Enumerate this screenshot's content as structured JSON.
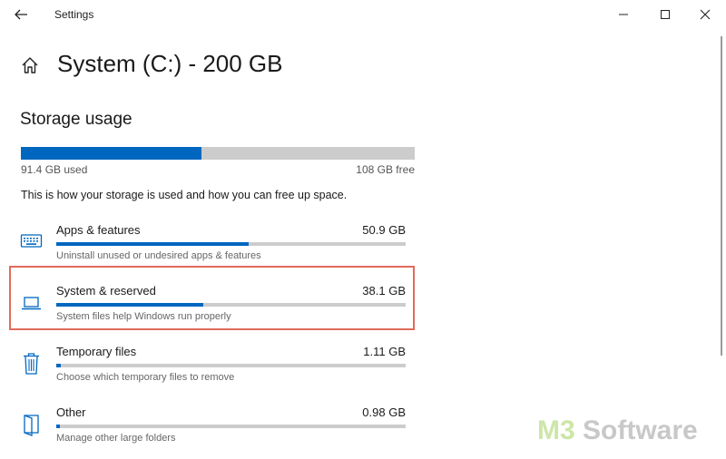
{
  "window": {
    "title": "Settings"
  },
  "page": {
    "title": "System (C:) - 200 GB"
  },
  "storage": {
    "heading": "Storage usage",
    "used_fraction": 0.458,
    "used_label": "91.4 GB used",
    "free_label": "108 GB free",
    "description": "This is how your storage is used and how you can free up space."
  },
  "categories": [
    {
      "icon": "keyboard-icon",
      "name": "Apps & features",
      "size": "50.9 GB",
      "fraction": 0.55,
      "hint": "Uninstall unused or undesired apps & features"
    },
    {
      "icon": "laptop-icon",
      "name": "System & reserved",
      "size": "38.1 GB",
      "fraction": 0.42,
      "hint": "System files help Windows run properly"
    },
    {
      "icon": "trash-icon",
      "name": "Temporary files",
      "size": "1.11 GB",
      "fraction": 0.012,
      "hint": "Choose which temporary files to remove"
    },
    {
      "icon": "folder-icon",
      "name": "Other",
      "size": "0.98 GB",
      "fraction": 0.011,
      "hint": "Manage other large folders"
    }
  ],
  "watermark": {
    "part1": "M3",
    "part2": " Software"
  },
  "colors": {
    "accent": "#0067c0",
    "track": "#cccccc",
    "highlight": "#e06b5c"
  }
}
